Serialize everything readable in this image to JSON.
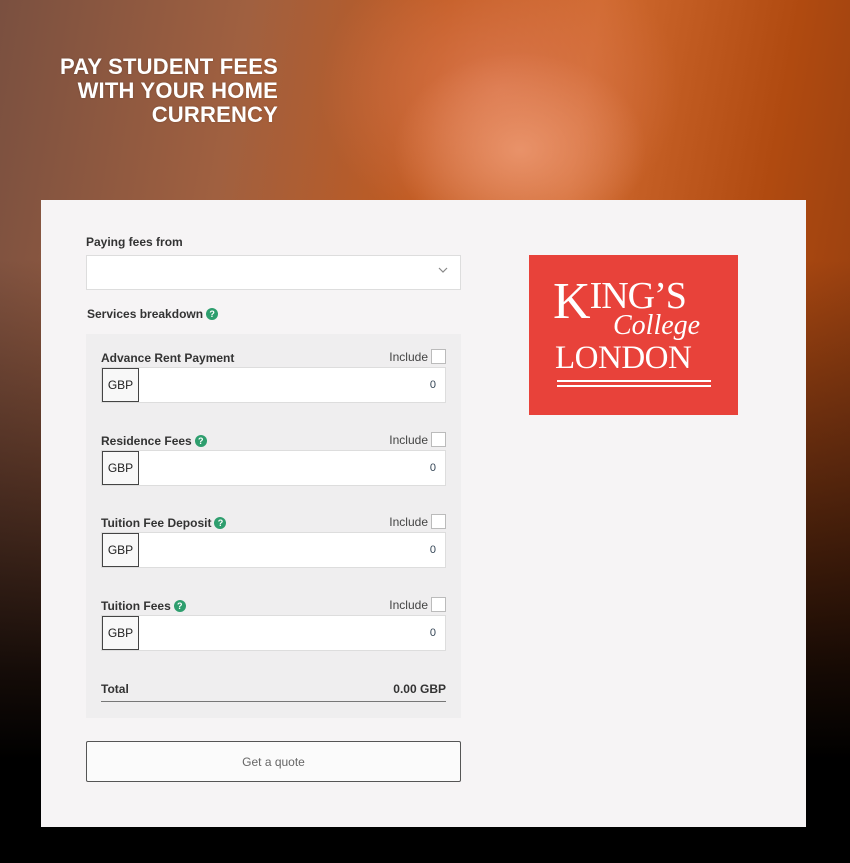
{
  "hero": {
    "title_lines": [
      "PAY STUDENT FEES",
      "WITH YOUR HOME",
      "CURRENCY"
    ]
  },
  "form": {
    "paying_from_label": "Paying fees from",
    "paying_from_value": "",
    "services_label": "Services breakdown",
    "help_glyph": "?",
    "include_label": "Include",
    "services": [
      {
        "name": "Advance Rent Payment",
        "has_help": false,
        "currency": "GBP",
        "amount": "0",
        "included": false
      },
      {
        "name": "Residence Fees",
        "has_help": true,
        "currency": "GBP",
        "amount": "0",
        "included": false
      },
      {
        "name": "Tuition Fee Deposit",
        "has_help": true,
        "currency": "GBP",
        "amount": "0",
        "included": false
      },
      {
        "name": "Tuition Fees",
        "has_help": true,
        "currency": "GBP",
        "amount": "0",
        "included": false
      }
    ],
    "total_label": "Total",
    "total_value": "0.00 GBP",
    "quote_button": "Get a quote"
  },
  "logo": {
    "line1_initial": "K",
    "line1_rest": "ING’S",
    "line2": "College",
    "line3": "LONDON",
    "background_color": "#e8423a"
  },
  "colors": {
    "help_icon": "#2e9e6e",
    "card_bg": "#f6f4f5"
  }
}
